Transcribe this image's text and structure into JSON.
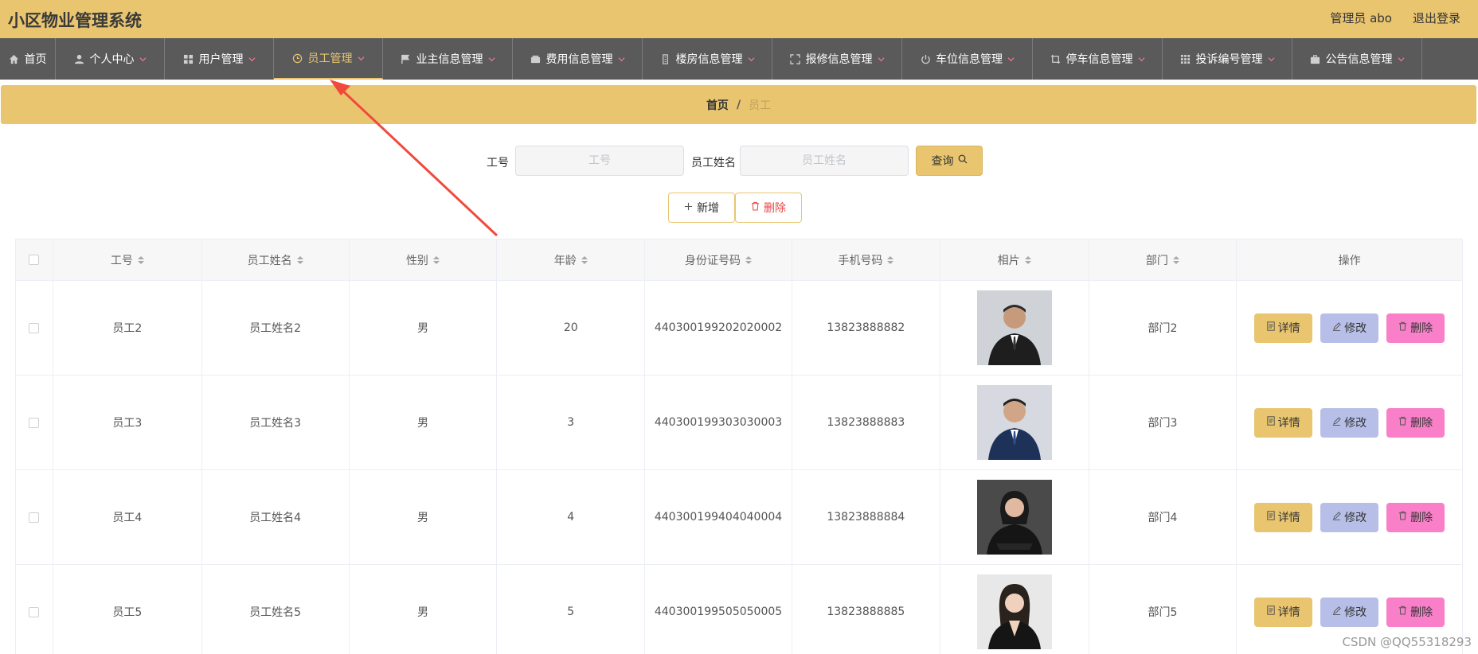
{
  "app": {
    "title": "小区物业管理系统"
  },
  "header": {
    "user_label": "管理员 abo",
    "logout_label": "退出登录"
  },
  "nav": [
    {
      "label": "首页",
      "icon": "home-icon",
      "has_dropdown": false,
      "active": false
    },
    {
      "label": "个人中心",
      "icon": "user-icon",
      "has_dropdown": true,
      "active": false
    },
    {
      "label": "用户管理",
      "icon": "grid-icon",
      "has_dropdown": true,
      "active": false
    },
    {
      "label": "员工管理",
      "icon": "clock-icon",
      "has_dropdown": true,
      "active": true
    },
    {
      "label": "业主信息管理",
      "icon": "flag-icon",
      "has_dropdown": true,
      "active": false
    },
    {
      "label": "费用信息管理",
      "icon": "wallet-icon",
      "has_dropdown": true,
      "active": false
    },
    {
      "label": "楼房信息管理",
      "icon": "building-icon",
      "has_dropdown": true,
      "active": false
    },
    {
      "label": "报修信息管理",
      "icon": "fullscreen-icon",
      "has_dropdown": true,
      "active": false
    },
    {
      "label": "车位信息管理",
      "icon": "power-icon",
      "has_dropdown": true,
      "active": false
    },
    {
      "label": "停车信息管理",
      "icon": "crop-icon",
      "has_dropdown": true,
      "active": false
    },
    {
      "label": "投诉编号管理",
      "icon": "apps-icon",
      "has_dropdown": true,
      "active": false
    },
    {
      "label": "公告信息管理",
      "icon": "briefcase-icon",
      "has_dropdown": true,
      "active": false
    }
  ],
  "breadcrumb": {
    "home": "首页",
    "separator": "/",
    "current": "员工"
  },
  "search": {
    "emp_no_label": "工号",
    "emp_no_placeholder": "工号",
    "emp_name_label": "员工姓名",
    "emp_name_placeholder": "员工姓名",
    "query_label": "查询"
  },
  "actions": {
    "add_label": "新增",
    "delete_label": "删除"
  },
  "table": {
    "columns": [
      "工号",
      "员工姓名",
      "性别",
      "年龄",
      "身份证号码",
      "手机号码",
      "相片",
      "部门",
      "操作"
    ],
    "rows": [
      {
        "no": "员工2",
        "name": "员工姓名2",
        "gender": "男",
        "age": "20",
        "id_card": "440300199202020002",
        "phone": "13823888882",
        "dept": "部门2"
      },
      {
        "no": "员工3",
        "name": "员工姓名3",
        "gender": "男",
        "age": "3",
        "id_card": "440300199303030003",
        "phone": "13823888883",
        "dept": "部门3"
      },
      {
        "no": "员工4",
        "name": "员工姓名4",
        "gender": "男",
        "age": "4",
        "id_card": "440300199404040004",
        "phone": "13823888884",
        "dept": "部门4"
      },
      {
        "no": "员工5",
        "name": "员工姓名5",
        "gender": "男",
        "age": "5",
        "id_card": "440300199505050005",
        "phone": "13823888885",
        "dept": "部门5"
      }
    ],
    "row_ops": {
      "detail": "详情",
      "edit": "修改",
      "remove": "删除"
    }
  },
  "watermark": "CSDN @QQ55318293",
  "colors": {
    "accent": "#e9c56f",
    "nav_bg": "#5a5a5a",
    "edit_btn": "#b7bfe8",
    "delete_btn": "#f97fc9",
    "annotation_arrow": "#f04a3c"
  }
}
